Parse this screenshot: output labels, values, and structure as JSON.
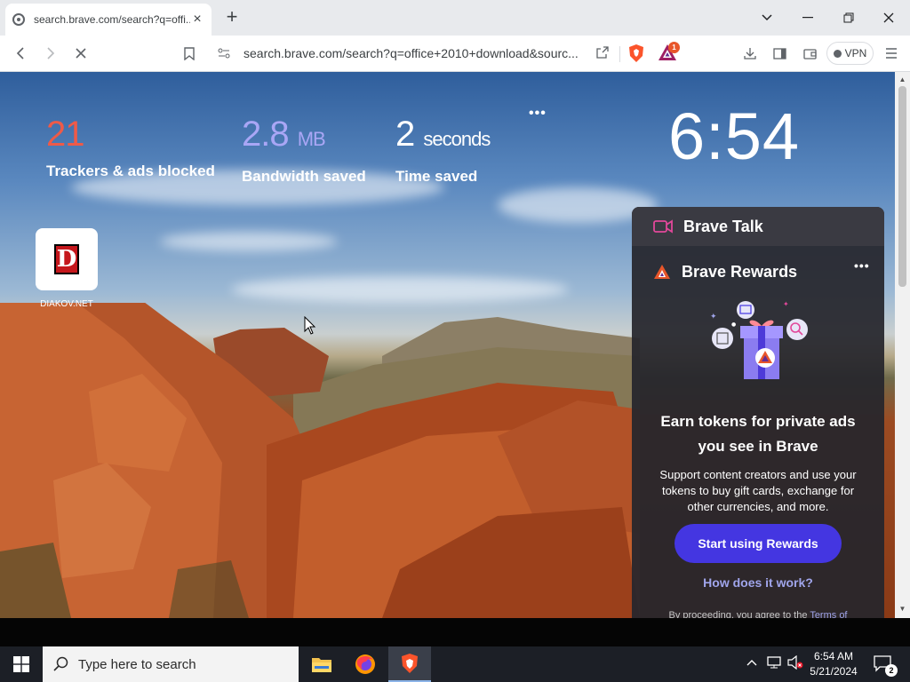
{
  "browser": {
    "tab": {
      "title": "search.brave.com/search?q=offi..."
    },
    "url": "search.brave.com/search?q=office+2010+download&sourc...",
    "rewards_badge": "1",
    "vpn_label": "VPN"
  },
  "stats": {
    "trackers": {
      "value": "21",
      "label": "Trackers & ads blocked"
    },
    "bandwidth": {
      "value": "2.8",
      "unit": "MB",
      "label": "Bandwidth saved"
    },
    "time": {
      "value": "2",
      "unit": "seconds",
      "label": "Time saved"
    }
  },
  "clock": "6:54",
  "top_sites": [
    {
      "label": "DIAKOV.NET",
      "logo_letter": "D"
    }
  ],
  "widget": {
    "talk_title": "Brave Talk",
    "rewards_title": "Brave Rewards",
    "headline": "Earn tokens for private ads you see in Brave",
    "description": "Support content creators and use your tokens to buy gift cards, exchange for other currencies, and more.",
    "cta": "Start using Rewards",
    "how_link": "How does it work?",
    "terms_prefix": "By proceeding, you agree to the",
    "terms_link": "Terms of"
  },
  "taskbar": {
    "search_placeholder": "Type here to search",
    "time": "6:54 AM",
    "date": "5/21/2024",
    "notification_count": "2"
  },
  "colors": {
    "trackers_accent": "#ee5a48",
    "bandwidth_accent": "#a9a6f5",
    "cta_button": "#4436e1",
    "link": "#a0a5eb"
  }
}
